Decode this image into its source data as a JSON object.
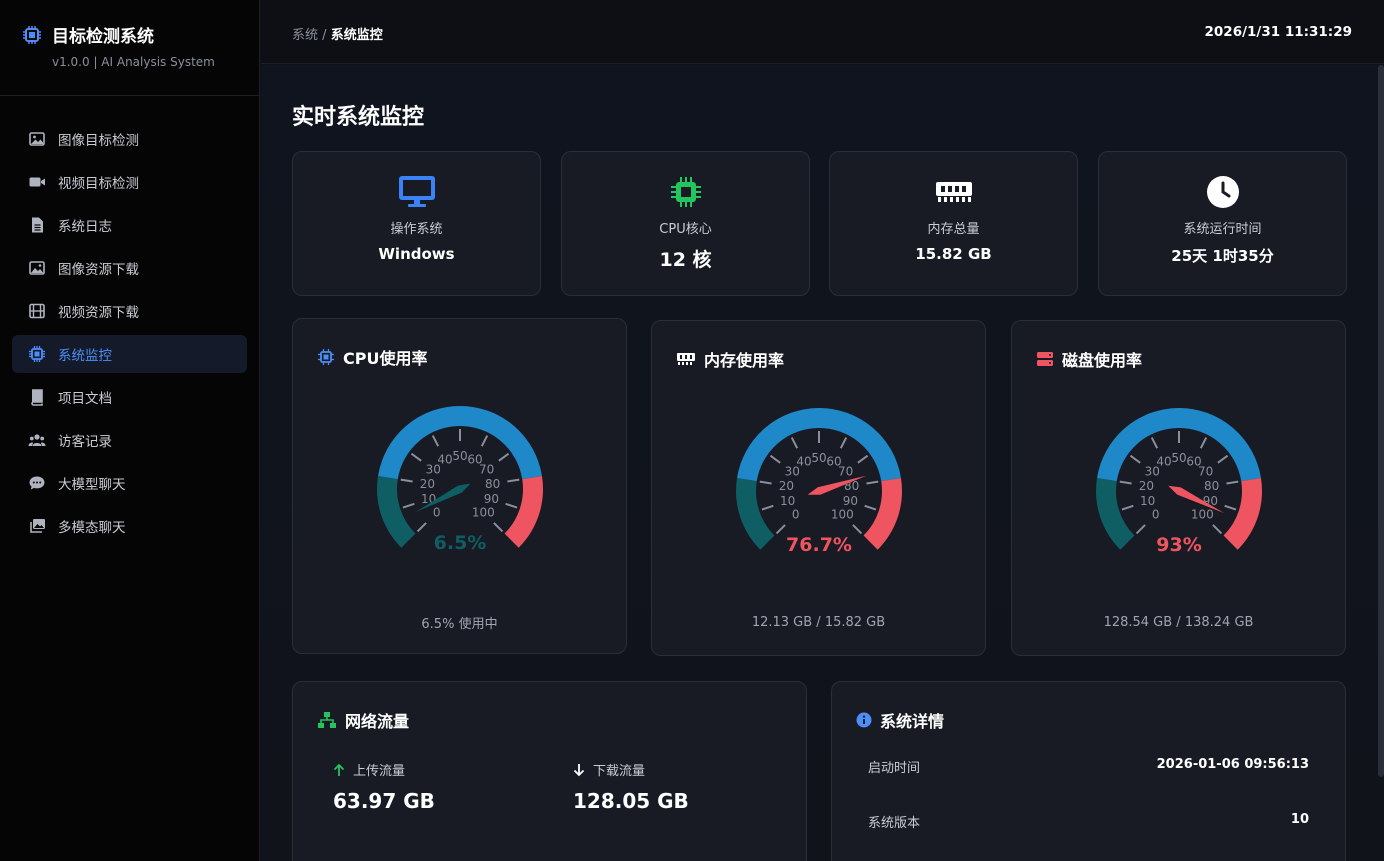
{
  "app": {
    "title": "目标检测系统",
    "subtitle": "v1.0.0 | AI Analysis System",
    "accent": "#4c8ef7"
  },
  "sidebar": {
    "items": [
      {
        "label": "图像目标检测",
        "icon": "image-icon",
        "active": false
      },
      {
        "label": "视频目标检测",
        "icon": "video-camera-icon",
        "active": false
      },
      {
        "label": "系统日志",
        "icon": "file-icon",
        "active": false
      },
      {
        "label": "图像资源下载",
        "icon": "images-icon",
        "active": false
      },
      {
        "label": "视频资源下载",
        "icon": "film-icon",
        "active": false
      },
      {
        "label": "系统监控",
        "icon": "chip-icon",
        "active": true
      },
      {
        "label": "项目文档",
        "icon": "book-icon",
        "active": false
      },
      {
        "label": "访客记录",
        "icon": "users-icon",
        "active": false
      },
      {
        "label": "大模型聊天",
        "icon": "chat-icon",
        "active": false
      },
      {
        "label": "多模态聊天",
        "icon": "photo-stack-icon",
        "active": false
      }
    ]
  },
  "header": {
    "breadcrumb_parent": "系统",
    "breadcrumb_sep": "/",
    "breadcrumb_current": "系统监控",
    "datetime": "2026/1/31 11:31:29"
  },
  "main": {
    "title": "实时系统监控",
    "stats": [
      {
        "label": "操作系统",
        "value": "Windows",
        "icon": "monitor-icon",
        "color": "#3b82f6"
      },
      {
        "label": "CPU核心",
        "value": "12 核",
        "icon": "chip-icon",
        "color": "#22c55e"
      },
      {
        "label": "内存总量",
        "value": "15.82 GB",
        "icon": "memory-icon",
        "color": "#ffffff"
      },
      {
        "label": "系统运行时间",
        "value": "25天 1时35分",
        "icon": "clock-icon",
        "color": "#ffffff"
      }
    ],
    "gauges": [
      {
        "title": "CPU使用率",
        "icon": "chip-icon",
        "value": 6.5,
        "value_label": "6.5%",
        "footer": "6.5% 使用中",
        "value_color": "#0e5e63"
      },
      {
        "title": "内存使用率",
        "icon": "memory-icon",
        "value": 76.7,
        "value_label": "76.7%",
        "footer": "12.13 GB / 15.82 GB",
        "value_color": "#ef5561"
      },
      {
        "title": "磁盘使用率",
        "icon": "disk-icon",
        "value": 93,
        "value_label": "93%",
        "footer": "128.54 GB / 138.24 GB",
        "value_color": "#ef5561"
      }
    ],
    "gauge_ticks": [
      "0",
      "10",
      "20",
      "30",
      "40",
      "50",
      "60",
      "70",
      "80",
      "90",
      "100"
    ],
    "gauge_colors": {
      "low": "#0e5e63",
      "mid": "#1e88c8",
      "high": "#ef5561"
    },
    "network": {
      "title": "网络流量",
      "upload_label": "上传流量",
      "upload_value": "63.97 GB",
      "download_label": "下载流量",
      "download_value": "128.05 GB"
    },
    "details": {
      "title": "系统详情",
      "rows": [
        {
          "key": "启动时间",
          "value": "2026-01-06 09:56:13"
        },
        {
          "key": "系统版本",
          "value": "10"
        }
      ]
    }
  }
}
